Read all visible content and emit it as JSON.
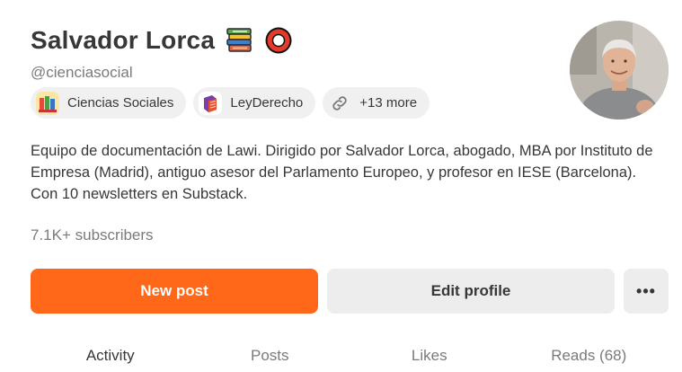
{
  "profile": {
    "name": "Salvador Lorca",
    "handle": "@cienciasocial",
    "bio": "Equipo de documentación de Lawi. Dirigido por Salvador Lorca, abogado, MBA por Instituto de Empresa (Madrid), antiguo asesor del Parlamento Europeo, y profesor en IESE (Barcelona). Con 10 newsletters en Substack.",
    "subscribers": "7.1K+ subscribers",
    "badges": [
      "books-icon",
      "lifebuoy-icon"
    ]
  },
  "publications": [
    {
      "label": "Ciencias Sociales",
      "icon": "ciencias-sociales-logo"
    },
    {
      "label": "LeyDerecho",
      "icon": "leyderecho-logo"
    },
    {
      "label": "+13 more",
      "icon": "link-icon"
    }
  ],
  "actions": {
    "new_post": "New post",
    "edit_profile": "Edit profile",
    "more": "•••"
  },
  "tabs": [
    {
      "label": "Activity",
      "active": true
    },
    {
      "label": "Posts",
      "active": false
    },
    {
      "label": "Likes",
      "active": false
    },
    {
      "label": "Reads (68)",
      "active": false
    }
  ],
  "colors": {
    "accent": "#ff6719",
    "text": "#363737",
    "muted": "#7a7a7a",
    "chip_bg": "#f0f0f0",
    "button_bg": "#ededed"
  }
}
